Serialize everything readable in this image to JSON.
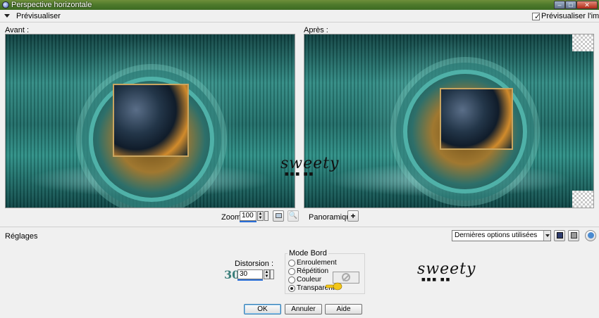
{
  "window": {
    "title": "Perspective horizontale"
  },
  "preview_bar": {
    "label": "Prévisualiser",
    "preview_image_label": "Prévisualiser l'image",
    "preview_image_checked": true
  },
  "panes": {
    "before_label": "Avant :",
    "after_label": "Après :"
  },
  "watermark": {
    "text": "sweety",
    "squares": "■■■ ■■"
  },
  "zoom": {
    "label": "Zoom :",
    "value": "100",
    "pan_label": "Panoramique :",
    "pan_symbol": "+"
  },
  "reglages": {
    "label": "Réglages",
    "preset_value": "Dernières options utilisées"
  },
  "distortion": {
    "label": "Distorsion :",
    "big_value": "30",
    "value": "30"
  },
  "edge_mode": {
    "title": "Mode Bord",
    "options": [
      {
        "label": "Enroulement",
        "selected": false
      },
      {
        "label": "Répétition",
        "selected": false
      },
      {
        "label": "Couleur",
        "selected": false
      },
      {
        "label": "Transparent",
        "selected": true
      }
    ]
  },
  "buttons": {
    "ok": "OK",
    "cancel": "Annuler",
    "help": "Aide"
  }
}
